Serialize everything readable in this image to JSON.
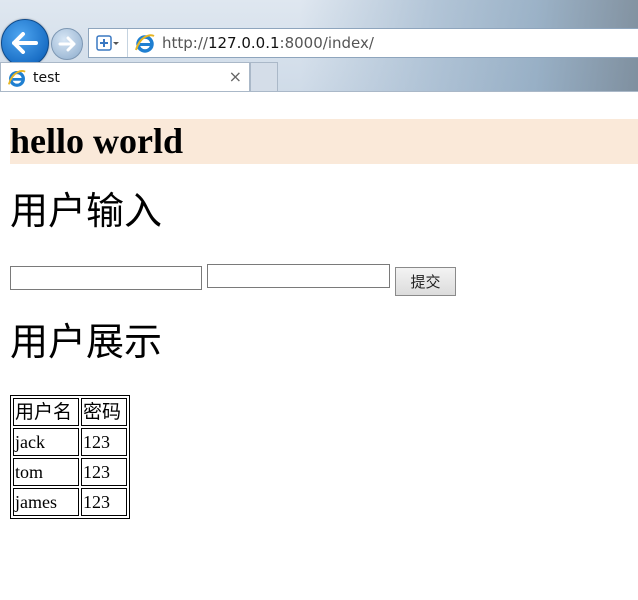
{
  "browser": {
    "address": {
      "scheme": "http://",
      "host": "127.0.0.1",
      "rest": ":8000/index/"
    },
    "tab": {
      "title": "test",
      "close_glyph": "×"
    },
    "icons": [
      "back-arrow-icon",
      "forward-arrow-icon",
      "site-shield-icon",
      "ie-logo-icon",
      "close-icon"
    ]
  },
  "page": {
    "heading": "hello world",
    "input_section_title": "用户输入",
    "show_section_title": "用户展示",
    "form": {
      "field1_value": "",
      "field2_value": "",
      "submit_label": "提交"
    },
    "table": {
      "headers": [
        "用户名",
        "密码"
      ],
      "rows": [
        [
          "jack",
          "123"
        ],
        [
          "tom",
          "123"
        ],
        [
          "james",
          "123"
        ]
      ]
    },
    "colors": {
      "banner_bg": "#fae9d9",
      "back_button": "#1a6fc6"
    }
  }
}
